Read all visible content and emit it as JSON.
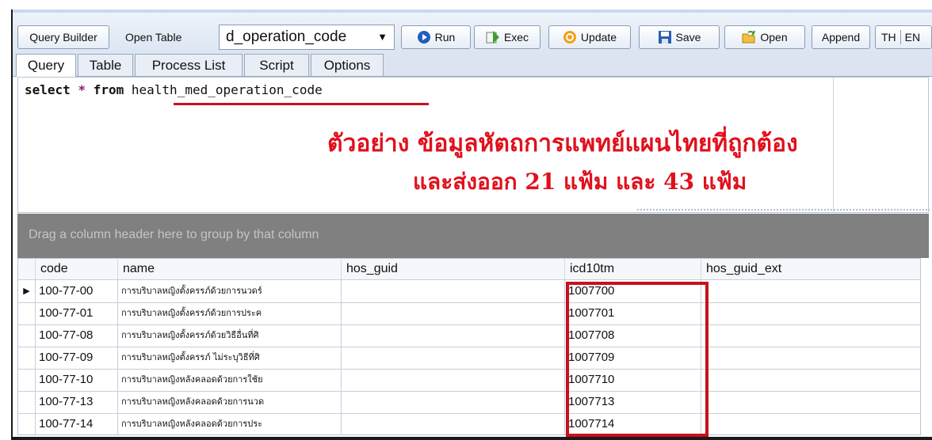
{
  "toolbar": {
    "query_builder_label": "Query Builder",
    "open_table_label": "Open Table",
    "table_select_value": "d_operation_code",
    "run_label": "Run",
    "exec_label": "Exec",
    "update_label": "Update",
    "save_label": "Save",
    "open_label": "Open",
    "append_label": "Append",
    "th_label": "TH",
    "en_label": "EN"
  },
  "tabs": [
    {
      "label": "Query",
      "active": true
    },
    {
      "label": "Table"
    },
    {
      "label": "Process List"
    },
    {
      "label": "Script"
    },
    {
      "label": "Options"
    }
  ],
  "editor": {
    "sql_select": "select",
    "sql_star": "*",
    "sql_from": "from",
    "sql_table": "health_med_operation_code",
    "note_line1": "ตัวอย่าง  ข้อมูลหัตถการแพทย์แผนไทยที่ถูกต้อง",
    "note_line2": "และส่งออก 21 แฟ้ม และ 43 แฟ้ม"
  },
  "grid": {
    "group_panel_text": "Drag a column header here to group by that column",
    "columns": [
      "code",
      "name",
      "hos_guid",
      "icd10tm",
      "hos_guid_ext"
    ],
    "rows": [
      {
        "code": "100-77-00",
        "name": "การบริบาลหญิงตั้งครรภ์ด้วยการนวดร์",
        "hos_guid": "",
        "icd10tm": "1007700",
        "hos_guid_ext": ""
      },
      {
        "code": "100-77-01",
        "name": "การบริบาลหญิงตั้งครรภ์ด้วยการประค",
        "hos_guid": "",
        "icd10tm": "1007701",
        "hos_guid_ext": ""
      },
      {
        "code": "100-77-08",
        "name": "การบริบาลหญิงตั้งครรภ์ด้วยวิธีอื่นที่ศิ",
        "hos_guid": "",
        "icd10tm": "1007708",
        "hos_guid_ext": ""
      },
      {
        "code": "100-77-09",
        "name": "การบริบาลหญิงตั้งครรภ์ ไม่ระบุวิธีที่ศิ",
        "hos_guid": "",
        "icd10tm": "1007709",
        "hos_guid_ext": ""
      },
      {
        "code": "100-77-10",
        "name": "การบริบาลหญิงหลังคลอดด้วยการใช้ย",
        "hos_guid": "",
        "icd10tm": "1007710",
        "hos_guid_ext": ""
      },
      {
        "code": "100-77-13",
        "name": "การบริบาลหญิงหลังคลอดด้วยการนวด",
        "hos_guid": "",
        "icd10tm": "1007713",
        "hos_guid_ext": ""
      },
      {
        "code": "100-77-14",
        "name": "การบริบาลหญิงหลังคลอดด้วยการประ",
        "hos_guid": "",
        "icd10tm": "1007714",
        "hos_guid_ext": ""
      }
    ]
  },
  "icons": {
    "run": "run-icon",
    "exec": "exec-icon",
    "update": "update-icon",
    "save": "save-icon",
    "open": "open-folder-icon",
    "dropdown": "chevron-down-icon",
    "row_indicator": "current-row-arrow-icon"
  },
  "colors": {
    "annotation_red": "#e0101c",
    "highlight_box": "#c8101c",
    "group_panel": "#808080"
  }
}
